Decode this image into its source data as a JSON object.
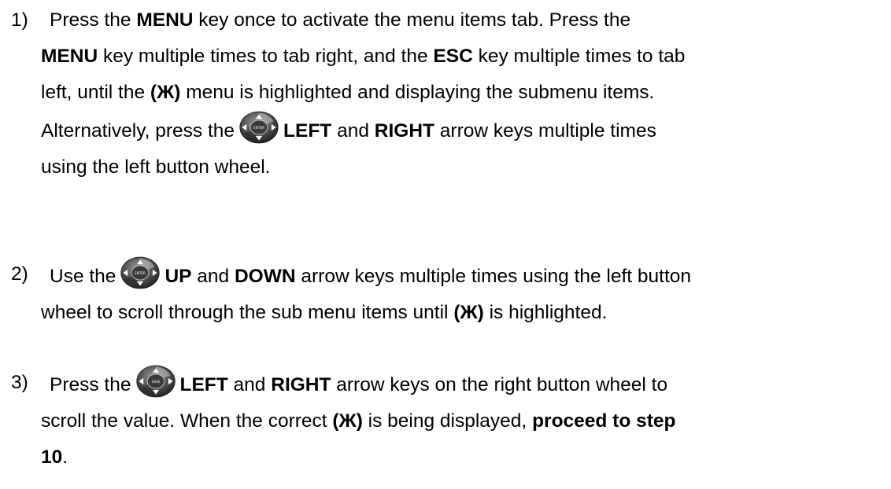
{
  "steps": [
    {
      "number": "1)",
      "lines": [
        [
          {
            "t": "Press the "
          },
          {
            "t": "MENU",
            "b": true
          },
          {
            "t": " key once to activate the menu items tab.  Press the"
          }
        ],
        [
          {
            "t": "MENU",
            "b": true
          },
          {
            "t": " key multiple times to tab right, and the "
          },
          {
            "t": "ESC",
            "b": true
          },
          {
            "t": " key multiple times to tab"
          }
        ],
        [
          {
            "t": "left, until the "
          },
          {
            "t": "(Ж)",
            "b": true
          },
          {
            "t": " menu is highlighted and displaying the submenu items."
          }
        ],
        [
          {
            "t": "Alternatively, press the"
          },
          {
            "icon": "direction-pad-icon",
            "label": "ENTER"
          },
          {
            "t": "LEFT",
            "b": true
          },
          {
            "t": " and "
          },
          {
            "t": "RIGHT",
            "b": true
          },
          {
            "t": " arrow keys multiple times"
          }
        ],
        [
          {
            "t": "using the left button wheel."
          }
        ]
      ]
    },
    {
      "number": "2)",
      "lines": [
        [
          {
            "t": "Use the"
          },
          {
            "icon": "direction-pad-icon",
            "label": "ENTER"
          },
          {
            "t": "UP",
            "b": true
          },
          {
            "t": " and "
          },
          {
            "t": "DOWN",
            "b": true
          },
          {
            "t": " arrow keys multiple times using the left button"
          }
        ],
        [
          {
            "t": "wheel to scroll through the sub menu items until "
          },
          {
            "t": "(Ж)",
            "b": true
          },
          {
            "t": " is highlighted."
          }
        ]
      ]
    },
    {
      "number": "3)",
      "lines": [
        [
          {
            "t": "Press the"
          },
          {
            "icon": "direction-pad-icon",
            "label": "SAVE"
          },
          {
            "t": "LEFT",
            "b": true
          },
          {
            "t": " and "
          },
          {
            "t": "RIGHT",
            "b": true
          },
          {
            "t": " arrow keys on the right button wheel to"
          }
        ],
        [
          {
            "t": "scroll the value.  When the correct "
          },
          {
            "t": "(Ж)",
            "b": true
          },
          {
            "t": " is being displayed, "
          },
          {
            "t": "proceed to step",
            "b": true
          }
        ],
        [
          {
            "t": "10",
            "b": true
          },
          {
            "t": "."
          }
        ]
      ]
    }
  ]
}
